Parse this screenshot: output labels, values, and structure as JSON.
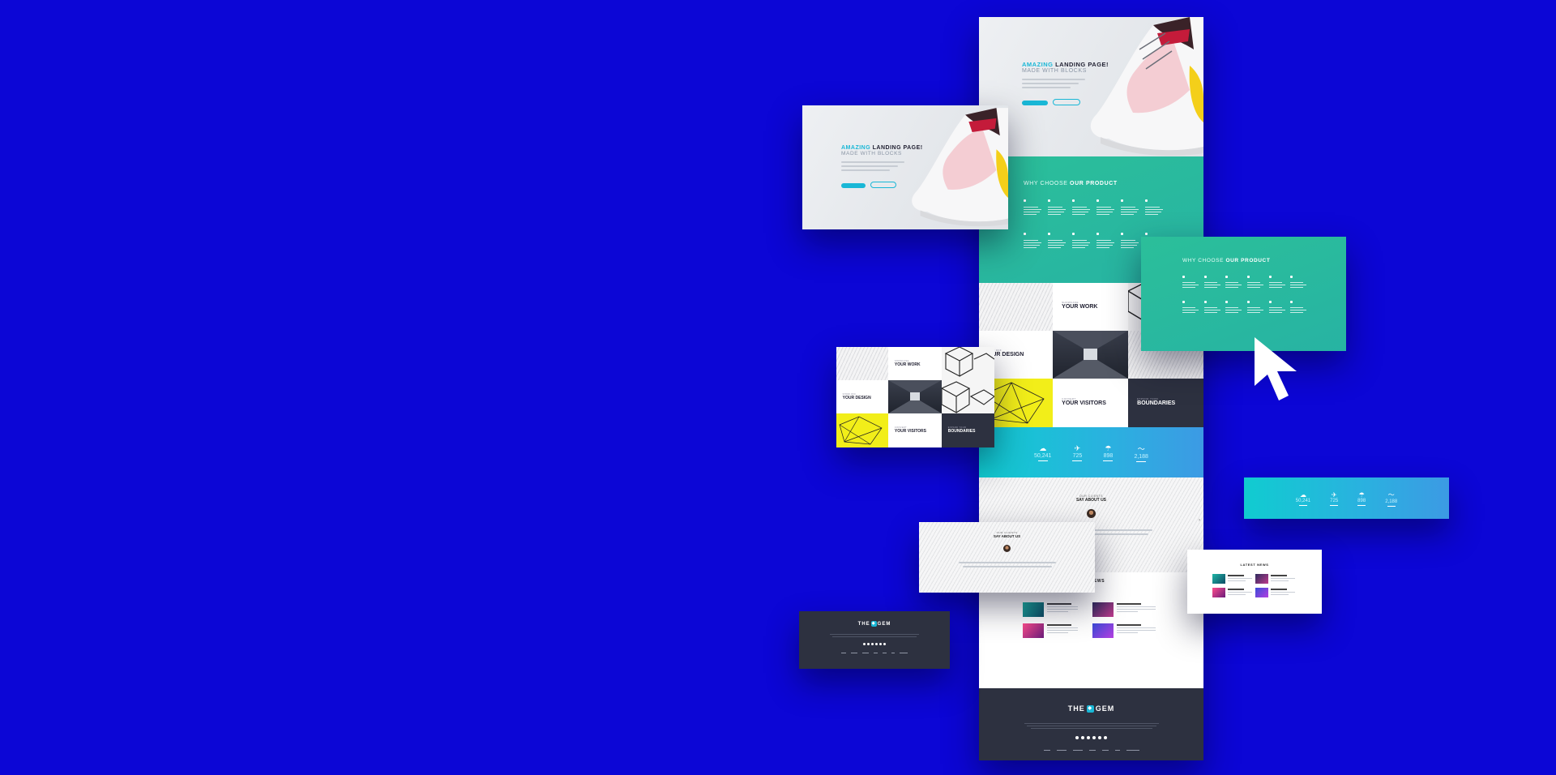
{
  "hero": {
    "title_accent": "AMAZING",
    "title_rest": "LANDING PAGE!",
    "subtitle": "MADE WITH BLOCKS"
  },
  "features": {
    "lead": "WHY CHOOSE",
    "strong": "OUR PRODUCT"
  },
  "showcase": {
    "t1_small": "SHOWCASE",
    "t1_big": "YOUR WORK",
    "t2_small": "SHOW OFF",
    "t2_big": "YOUR DESIGN",
    "t2_big_clip": "UR DESIGN",
    "t2_small_clip": "W OFF",
    "t3_small": "CONVERT",
    "t3_big": "YOUR VISITORS",
    "t4_small": "EXPAND YOUR",
    "t4_big": "BOUNDARIES"
  },
  "stats": {
    "items": [
      {
        "icon": "cloud-icon",
        "value": "50,241"
      },
      {
        "icon": "satellite-icon",
        "value": "725"
      },
      {
        "icon": "umbrella-icon",
        "value": "898"
      },
      {
        "icon": "pulse-icon",
        "value": "2,188"
      }
    ]
  },
  "testimonials": {
    "small": "OUR CLIENTS",
    "big": "SAY ABOUT US"
  },
  "news": {
    "title": "LATEST NEWS",
    "title_clip": "IEWS"
  },
  "footer": {
    "logo_left": "THE",
    "logo_right": "GEM"
  },
  "colors": {
    "background": "#0c06d6",
    "accent": "#19b7d6",
    "green": "#2bbf9a",
    "dark": "#2d3140",
    "yellow": "#f2ee19"
  }
}
